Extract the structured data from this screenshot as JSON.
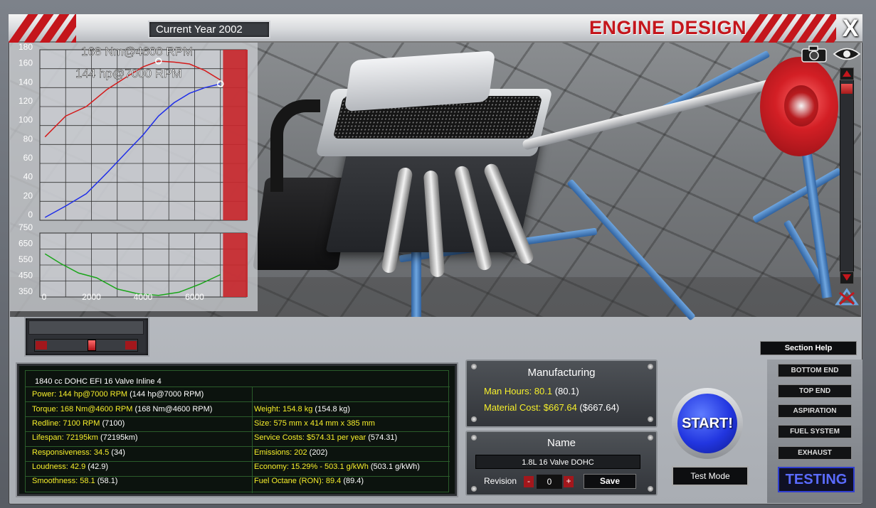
{
  "header": {
    "current_year": "Current Year 2002",
    "title": "ENGINE DESIGN",
    "close_label": "X"
  },
  "chart": {
    "torque_peak_label": "168 Nm@4600 RPM",
    "power_peak_label": "144 hp@7000 RPM",
    "top_y_ticks": [
      "180",
      "160",
      "140",
      "120",
      "100",
      "80",
      "60",
      "40",
      "20",
      "0"
    ],
    "bottom_y_ticks": [
      "750",
      "650",
      "550",
      "450",
      "350"
    ],
    "x_ticks": [
      "0",
      "2000",
      "4000",
      "6000"
    ]
  },
  "chart_data": [
    {
      "type": "line",
      "ylim": [
        0,
        180
      ],
      "xlim": [
        0,
        8000
      ],
      "redline": 7100,
      "series": [
        {
          "color": "#d41a1a",
          "x": [
            200,
            1000,
            1800,
            2600,
            3400,
            4000,
            4600,
            5200,
            5800,
            6400,
            7000
          ],
          "y": [
            88,
            110,
            120,
            138,
            152,
            162,
            168,
            167,
            165,
            158,
            148
          ]
        },
        {
          "color": "#1f2ee8",
          "x": [
            200,
            1000,
            1800,
            2600,
            3400,
            4000,
            4600,
            5200,
            5800,
            6400,
            7000
          ],
          "y": [
            3,
            15,
            28,
            50,
            73,
            90,
            110,
            124,
            134,
            140,
            144
          ]
        }
      ],
      "markers": [
        {
          "x": 4600,
          "y": 168
        },
        {
          "x": 7000,
          "y": 144
        }
      ]
    },
    {
      "type": "line",
      "ylim": [
        350,
        750
      ],
      "xlim": [
        0,
        8000
      ],
      "series": [
        {
          "color": "#1aa51a",
          "x": [
            200,
            800,
            1500,
            2200,
            3000,
            3800,
            4600,
            5400,
            6200,
            7000
          ],
          "y": [
            620,
            560,
            500,
            470,
            400,
            370,
            360,
            380,
            430,
            490
          ]
        }
      ]
    }
  ],
  "stats": {
    "engine_desc": "1840 cc DOHC EFI 16 Valve Inline 4",
    "left": [
      {
        "label": "Power: 144 hp@7000 RPM",
        "value": "(144 hp@7000 RPM)"
      },
      {
        "label": "Torque: 168 Nm@4600 RPM",
        "value": "(168 Nm@4600 RPM)"
      },
      {
        "label": "Redline: 7100 RPM",
        "value": "(7100)"
      },
      {
        "label": "Lifespan: 72195km",
        "value": "(72195km)"
      },
      {
        "label": "Responsiveness: 34.5",
        "value": "(34)"
      },
      {
        "label": "Loudness: 42.9",
        "value": "(42.9)"
      },
      {
        "label": "Smoothness: 58.1",
        "value": "(58.1)"
      }
    ],
    "right": [
      {
        "label": "Weight: 154.8 kg",
        "value": "(154.8 kg)"
      },
      {
        "label": "Size: 575 mm x 414 mm x 385 mm",
        "value": ""
      },
      {
        "label": "Service Costs: $574.31 per year",
        "value": "(574.31)"
      },
      {
        "label": "Emissions: 202",
        "value": "(202)"
      },
      {
        "label": "Economy: 15.29% - 503.1 g/kWh",
        "value": "(503.1 g/kWh)"
      },
      {
        "label": "Fuel Octane (RON): 89.4",
        "value": "(89.4)"
      }
    ]
  },
  "manufacturing": {
    "title": "Manufacturing",
    "man_hours_label": "Man Hours: 80.1",
    "man_hours_value": "(80.1)",
    "material_cost_label": "Material Cost: $667.64",
    "material_cost_value": "($667.64)"
  },
  "name_panel": {
    "title": "Name",
    "engine_name": "1.8L 16 Valve DOHC",
    "revision_label": "Revision",
    "revision_value": "0",
    "minus": "-",
    "plus": "+",
    "save_label": "Save"
  },
  "controls": {
    "start_label": "START!",
    "test_mode_label": "Test Mode"
  },
  "nav": {
    "section_help": "Section Help",
    "items": [
      "BOTTOM END",
      "TOP END",
      "ASPIRATION",
      "FUEL SYSTEM",
      "EXHAUST"
    ],
    "active": "TESTING"
  },
  "colors": {
    "accent_red": "#c4161c",
    "stat_yellow": "#f6ef2b",
    "start_blue": "#2236e0"
  }
}
